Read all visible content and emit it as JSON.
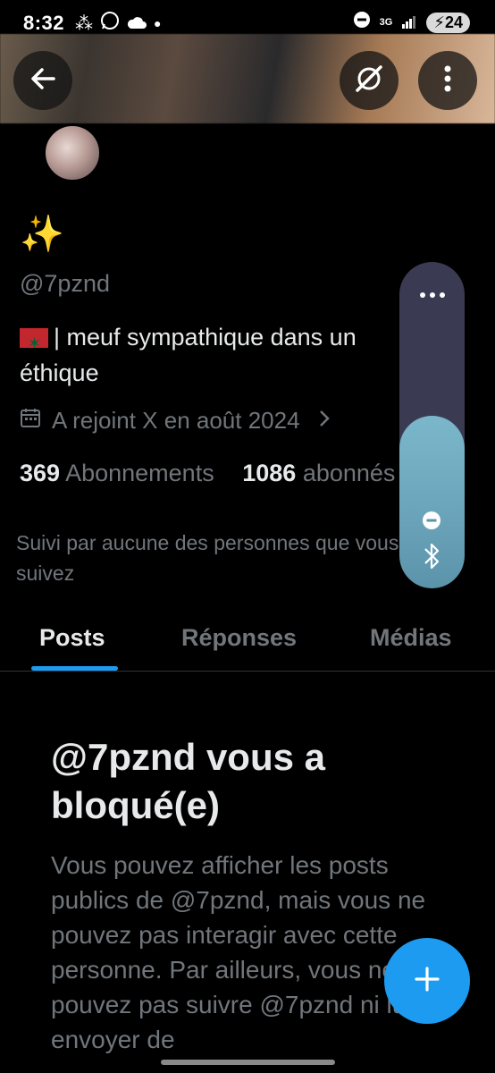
{
  "status_bar": {
    "time": "8:32",
    "network": "3G",
    "battery": "24"
  },
  "profile": {
    "display_name": "✨",
    "handle": "@7pznd",
    "bio": "| meuf sympathique dans un éthique",
    "joined": "A rejoint X en août 2024",
    "following_count": "369",
    "following_label": "Abonnements",
    "followers_count": "1086",
    "followers_label": "abonnés",
    "followed_by": "Suivi par aucune des personnes que vous suivez"
  },
  "tabs": [
    {
      "label": "Posts",
      "active": true
    },
    {
      "label": "Réponses",
      "active": false
    },
    {
      "label": "Médias",
      "active": false
    }
  ],
  "blocked": {
    "title": "@7pznd vous a bloqué(e)",
    "text": "Vous pouvez afficher les posts publics de @7pznd, mais vous ne pouvez pas interagir avec cette personne. Par ailleurs, vous ne pouvez pas suivre @7pznd ni lui envoyer de"
  },
  "volume": {
    "level": 0.53
  },
  "colors": {
    "accent": "#1d9bf0",
    "muted": "#71767b",
    "text": "#e7e9ea",
    "background": "#000000"
  },
  "icons": [
    "back-arrow-icon",
    "grok-icon",
    "more-vertical-icon",
    "calendar-icon",
    "chevron-right-icon",
    "more-horizontal-icon",
    "minus-circle-icon",
    "bluetooth-icon",
    "plus-icon"
  ]
}
